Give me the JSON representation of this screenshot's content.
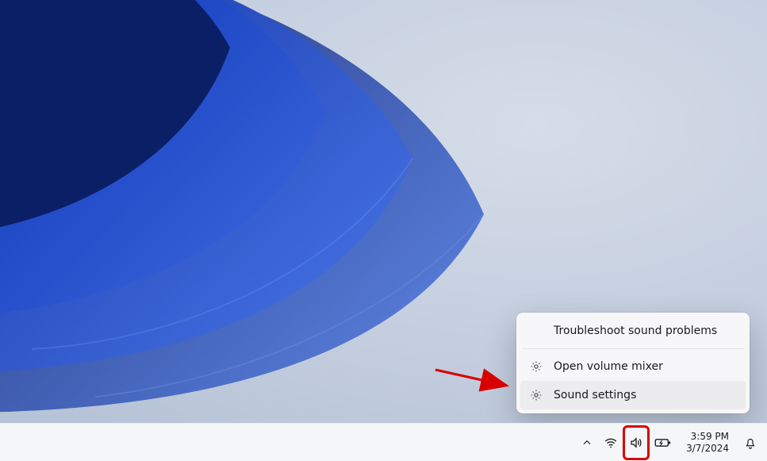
{
  "context_menu": {
    "items": [
      {
        "label": "Troubleshoot sound problems",
        "icon": "none"
      },
      {
        "label": "Open volume mixer",
        "icon": "gear"
      },
      {
        "label": "Sound settings",
        "icon": "gear"
      }
    ]
  },
  "taskbar": {
    "tray": {
      "chevron_icon": "chevron-up",
      "wifi_icon": "wifi",
      "volume_icon": "volume",
      "battery_icon": "battery",
      "notifications_icon": "bell"
    },
    "clock": {
      "time": "3:59 PM",
      "date": "3/7/2024"
    }
  },
  "annotation": {
    "arrow_color": "#d90000",
    "highlight_color": "#d90000"
  }
}
